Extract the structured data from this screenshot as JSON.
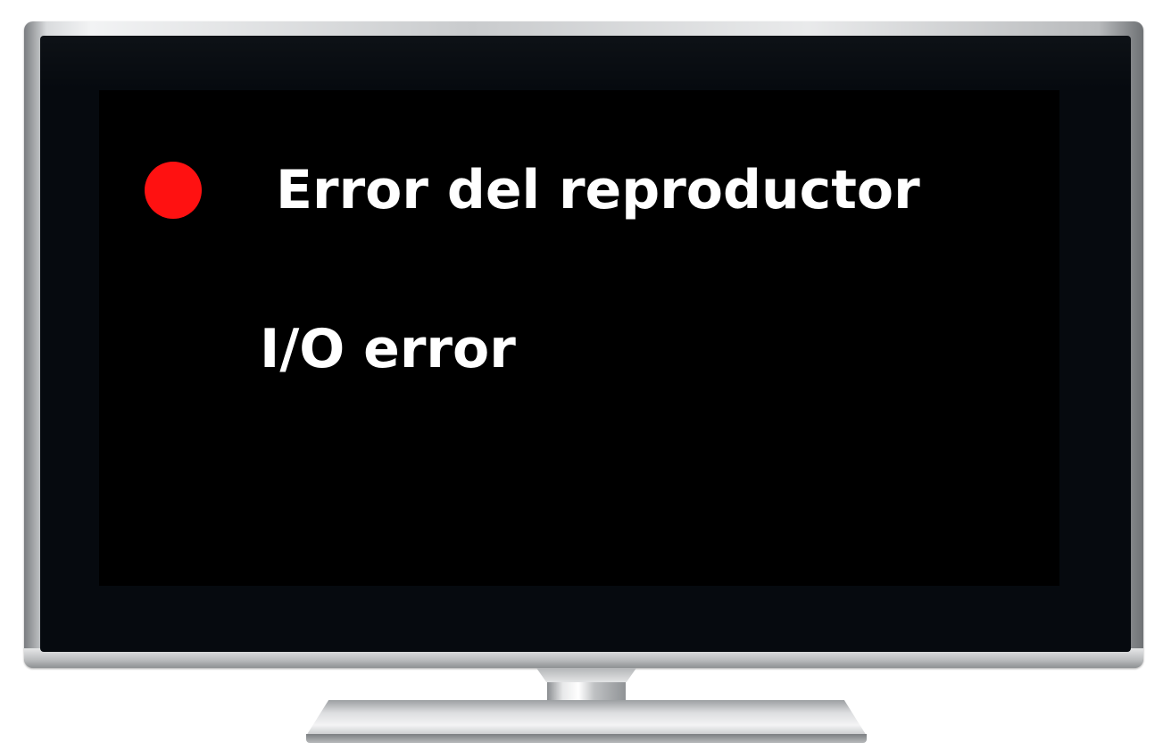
{
  "screen": {
    "title": "Error del reproductor",
    "detail": "I/O error"
  },
  "status": {
    "indicator_icon": "red-dot-icon",
    "indicator_color": "#ff1111"
  },
  "colors": {
    "screen_background": "#000000",
    "text": "#ffffff",
    "bezel": "#060a0f"
  }
}
